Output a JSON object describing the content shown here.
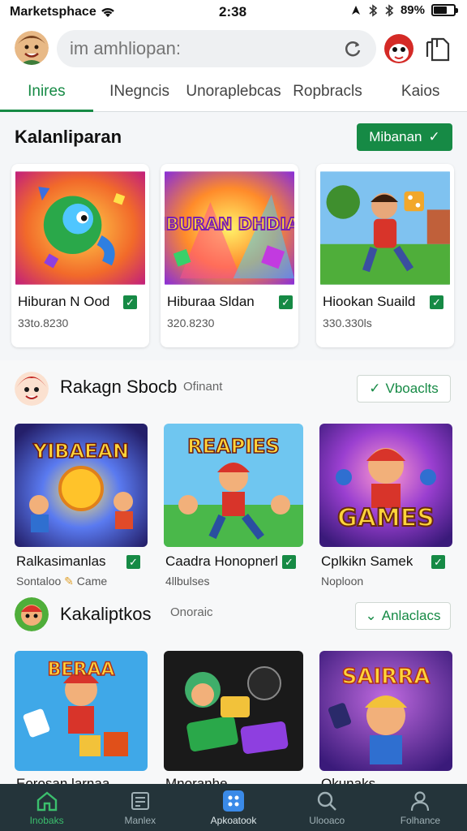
{
  "status_bar": {
    "carrier": "Marketsphace",
    "time": "2:38",
    "battery": "89%"
  },
  "header": {
    "search_placeholder": "im amhliopan:"
  },
  "tabs": [
    {
      "label": "Inires",
      "active": true
    },
    {
      "label": "INegncis"
    },
    {
      "label": "Unoraplebcas"
    },
    {
      "label": "Ropbracls"
    },
    {
      "label": "Kaios"
    }
  ],
  "section1": {
    "title": "Kalanliparan",
    "button_label": "Mibanan",
    "cards": [
      {
        "name": "Hiburan N Ood",
        "sub": "33to.8230",
        "art_text": ""
      },
      {
        "name": "Hiburaa Sldan",
        "sub": "320.8230",
        "art_text": "HIBURAN DHDIAN"
      },
      {
        "name": "Hiookan Suaild",
        "sub": "330.330ls",
        "art_text": ""
      }
    ]
  },
  "section2": {
    "title": "Rakagn Sbocb",
    "subtitle": "Ofinant",
    "button_label": "Vboaclts",
    "cards": [
      {
        "name": "Ralkasimanlas",
        "sub": "Sontaloo",
        "sub2": "Came",
        "art_text": "YIBAEAN"
      },
      {
        "name": "Caadra Honopnerl",
        "sub": "4llbulses",
        "art_text": "REAPIES"
      },
      {
        "name": "Cplkikn Samek",
        "sub": "Noploon",
        "art_text": "GAMES"
      }
    ]
  },
  "section3": {
    "title": "Kakaliptkos",
    "subtitle": "Onoraic",
    "button_label": "Anlaclacs",
    "cards": [
      {
        "name": "Eorosan larnaa",
        "art_text": "BERAA"
      },
      {
        "name": "Mnoranhe",
        "art_text": ""
      },
      {
        "name": "Okunaks",
        "art_text": "SAIRRA"
      }
    ]
  },
  "bottom_nav": [
    {
      "label": "Inobaks",
      "icon": "home-icon"
    },
    {
      "label": "Manlex",
      "icon": "list-icon"
    },
    {
      "label": "Apkoatook",
      "icon": "apps-grid-icon"
    },
    {
      "label": "Ulooaco",
      "icon": "search-icon"
    },
    {
      "label": "Folhance",
      "icon": "profile-icon"
    }
  ],
  "colors": {
    "accent": "#168a45",
    "nav_bg": "#24343a",
    "nav_active": "#3bbf6d"
  }
}
